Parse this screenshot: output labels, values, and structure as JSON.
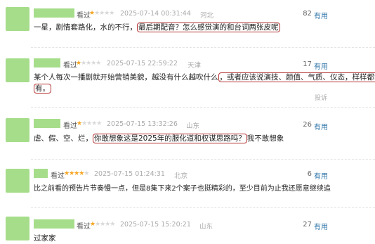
{
  "reviews": [
    {
      "label": "看过",
      "stars": "★★☆☆☆",
      "time": "2025-07-14 00:31:44",
      "location": "河北",
      "count": "82",
      "useful": "有用",
      "text_a": "一星，剧情套路化，水的不行，",
      "text_hl": "最后期配音？怎么感觉演的和台词两张皮呢",
      "text_b": ""
    },
    {
      "label": "看过",
      "stars": "★☆☆☆☆",
      "time": "2025-07-15 22:59:22",
      "location": "天津",
      "count": "17",
      "useful": "有用",
      "text_a": "某个人每次一播剧就开始营销美貌，越没有什么越吹什么",
      "text_hl": "，或者应该说演技、颜值、气质、仪态，样样都没",
      "text_line2": "有。",
      "report": "投诉"
    },
    {
      "label": "看过",
      "stars": "★☆☆☆☆",
      "time": "2025-07-15 13:32:26",
      "location": "山东",
      "count": "26",
      "useful": "有用",
      "text_a": "虐、假、空、烂，",
      "text_hl": "你敢想象这是2025年的服化道和权谋思路吗？",
      "text_b": "我不敢想象"
    },
    {
      "label": "看过",
      "stars": "★★★★☆",
      "time": "2025-07-15 01:24:31",
      "location": "北京",
      "count": "6",
      "useful": "有用",
      "text_a": "比之前看的预告片节奏慢一点，但是8集下来2个案子也挺精彩的，至少目前为止我还愿意继续追",
      "text_hl": "",
      "text_b": ""
    },
    {
      "label": "看过",
      "stars": "★☆☆☆☆",
      "time": "2025-07-15 15:20:21",
      "location": "山东",
      "count": "27",
      "useful": "有用",
      "text_a": "过家家",
      "text_hl": "",
      "text_b": ""
    }
  ]
}
